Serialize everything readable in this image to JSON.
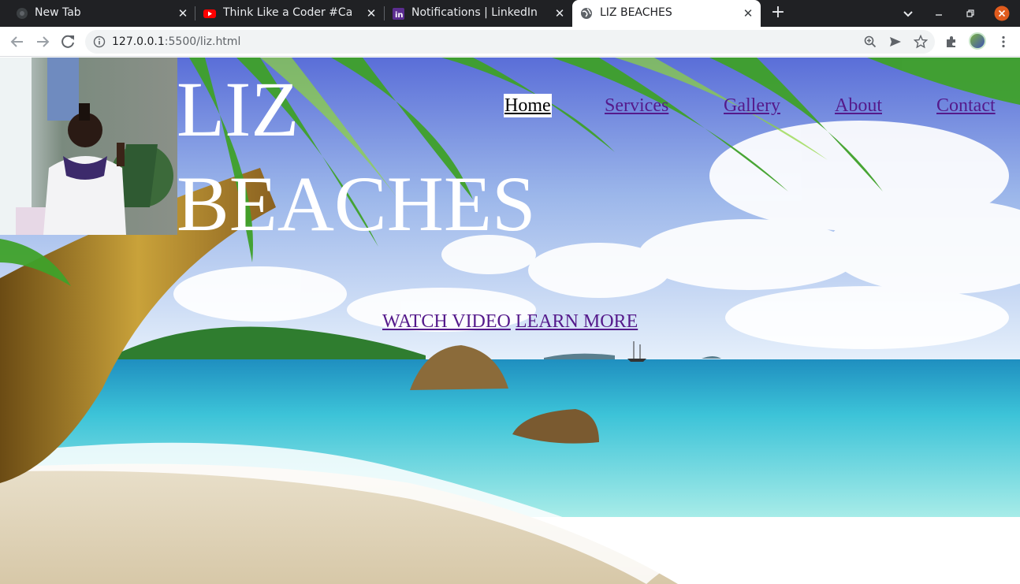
{
  "browser": {
    "tabs": [
      {
        "title": "New Tab",
        "icon": "chrome-icon"
      },
      {
        "title": "Think Like a Coder #Camp",
        "icon": "youtube-icon"
      },
      {
        "title": "Notifications | LinkedIn",
        "icon": "linkedin-icon"
      },
      {
        "title": "LIZ BEACHES",
        "icon": "globe-icon",
        "active": true
      }
    ],
    "address": {
      "host": "127.0.0.1",
      "path": ":5500/liz.html"
    }
  },
  "site": {
    "title_line1": "LIZ",
    "title_line2": "BEACHES",
    "nav": [
      {
        "label": "Home",
        "current": true
      },
      {
        "label": "Services"
      },
      {
        "label": "Gallery"
      },
      {
        "label": "About"
      },
      {
        "label": "Contact"
      }
    ],
    "cta": {
      "watch": "WATCH VIDEO",
      "learn": "LEARN MORE"
    }
  },
  "colors": {
    "link_visited": "#551a8b",
    "title": "#ffffff",
    "tab_strip": "#202124",
    "close_button": "#e05b1d"
  }
}
